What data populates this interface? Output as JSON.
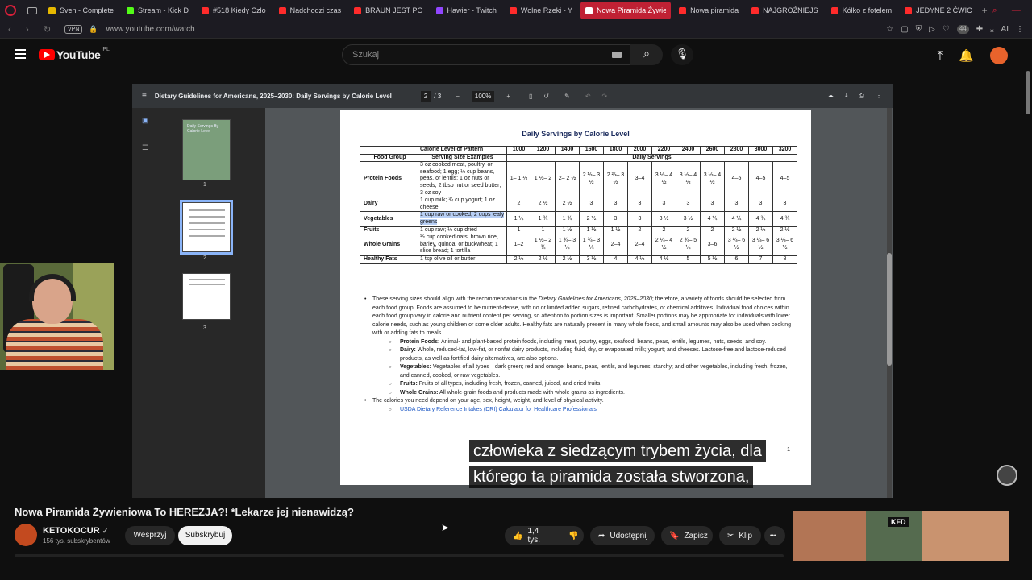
{
  "browser": {
    "tabs": [
      {
        "label": "Sven - Complete",
        "color": "#e6b800"
      },
      {
        "label": "Stream - Kick D",
        "color": "#53fc18"
      },
      {
        "label": "#518 Kiedy Czło",
        "color": "#ff2b2b"
      },
      {
        "label": "Nadchodzi czas",
        "color": "#ff2b2b"
      },
      {
        "label": "BRAUN JEST PO",
        "color": "#ff2b2b"
      },
      {
        "label": "Hawier - Twitch",
        "color": "#9146ff"
      },
      {
        "label": "Wolne Rzeki - Y",
        "color": "#ff2b2b"
      },
      {
        "label": "Nowa Piramida Żywien",
        "color": "#ffffff",
        "active": true
      },
      {
        "label": "Nowa piramida",
        "color": "#ff2b2b"
      },
      {
        "label": "NAJGROŹNIEJS",
        "color": "#ff2b2b"
      },
      {
        "label": "Kółko z fotelem",
        "color": "#ff2b2b"
      },
      {
        "label": "JEDYNE 2 ĆWIC",
        "color": "#ff2b2b"
      }
    ],
    "new_tab": "+",
    "url": "www.youtube.com/watch",
    "vpn": "VPN",
    "ext_badge": "44",
    "ai_label": "AI"
  },
  "youtube": {
    "logo": "YouTube",
    "country": "PL",
    "search_placeholder": "Szukaj"
  },
  "pdf": {
    "title": "Dietary Guidelines for Americans, 2025–2030: Daily Servings by Calorie Level",
    "page": "2",
    "of": "/ 3",
    "zoom": "100%",
    "thumb1_text": "Daily Servings By Calorie Level",
    "thumbs": [
      "1",
      "2",
      "3"
    ],
    "heading": "Daily Servings by Calorie Level",
    "table": {
      "h1": [
        "",
        "Calorie Level of Pattern",
        "1000",
        "1200",
        "1400",
        "1600",
        "1800",
        "2000",
        "2200",
        "2400",
        "2600",
        "2800",
        "3000",
        "3200"
      ],
      "h2": [
        "Food Group",
        "Serving Size Examples",
        "Daily Servings"
      ],
      "rows": [
        [
          "Protein Foods",
          "3 oz cooked meat, poultry, or seafood; 1 egg; ½ cup beans, peas, or lentils; 1 oz nuts or seeds; 2 tbsp nut or seed butter; 3 oz soy",
          "1– 1 ½",
          "1 ½– 2",
          "2– 2 ½",
          "2 ½– 3 ½",
          "2 ⅔– 3 ½",
          "3–4",
          "3 ½– 4 ½",
          "3 ½– 4 ½",
          "3 ½– 4 ½",
          "4–5",
          "4–5",
          "4–5"
        ],
        [
          "Dairy",
          "1 cup milk; ¾ cup yogurt; 1 oz cheese",
          "2",
          "2 ½",
          "2 ½",
          "3",
          "3",
          "3",
          "3",
          "3",
          "3",
          "3",
          "3",
          "3"
        ],
        [
          "Vegetables",
          "1 cup raw or cooked; 2 cups leafy greens",
          "1 ¼",
          "1 ¾",
          "1 ¾",
          "2 ½",
          "3",
          "3",
          "3 ½",
          "3 ½",
          "4 ¼",
          "4 ¼",
          "4 ¾",
          "4 ¾"
        ],
        [
          "Fruits",
          "1 cup raw; ½ cup dried",
          "1",
          "1",
          "1 ½",
          "1 ½",
          "1 ½",
          "2",
          "2",
          "2",
          "2",
          "2 ½",
          "2 ½",
          "2 ½"
        ],
        [
          "Whole Grains",
          "½ cup cooked oats, brown rice, barley, quinoa, or buckwheat; 1 slice bread; 1 tortilla",
          "1–2",
          "1 ½– 2 ¾",
          "1 ¾– 3 ¼",
          "1 ¾– 3 ¼",
          "2–4",
          "2–4",
          "2 ¼– 4 ½",
          "2 ¾– 5 ¼",
          "3–6",
          "3 ¼– 6 ½",
          "3 ¼– 6 ½",
          "3 ¼– 6 ½"
        ],
        [
          "Healthy Fats",
          "1 tsp olive oil or butter",
          "2 ½",
          "2 ½",
          "2 ½",
          "3 ½",
          "4",
          "4 ½",
          "4 ½",
          "5",
          "5 ½",
          "6",
          "7",
          "8"
        ]
      ]
    },
    "bullet1_a": "These serving sizes should align with the recommendations in the ",
    "bullet1_i": "Dietary Guidelines for Americans, 2025–2030",
    "bullet1_b": "; therefore, a variety of foods should be selected from each food group. Foods are assumed to be nutrient-dense, with no or limited added sugars, refined carbohydrates, or chemical additives. Individual food choices within each food group vary in calorie and nutrient content per serving, so attention to portion sizes is important. Smaller portions may be appropriate for individuals with lower calorie needs, such as young children or some older adults. Healthy fats are naturally present in many whole foods, and small amounts may also be used when cooking with or adding fats to meals.",
    "sub": [
      {
        "k": "Protein Foods:",
        "v": " Animal- and plant-based protein foods, including meat, poultry, eggs, seafood, beans, peas, lentils, legumes, nuts, seeds, and soy."
      },
      {
        "k": "Dairy:",
        "v": " Whole, reduced-fat, low-fat, or nonfat dairy products, including fluid, dry, or evaporated milk; yogurt; and cheeses. Lactose-free and lactose-reduced products, as well as fortified dairy alternatives, are also options."
      },
      {
        "k": "Vegetables:",
        "v": " Vegetables of all types—dark green; red and orange; beans, peas, lentils, and legumes; starchy; and other vegetables, including fresh, frozen, and canned, cooked, or raw vegetables."
      },
      {
        "k": "Fruits:",
        "v": " Fruits of all types, including fresh, frozen, canned, juiced, and dried fruits."
      },
      {
        "k": "Whole Grains:",
        "v": " All whole-grain foods and products made with whole grains as ingredients."
      }
    ],
    "bullet2": "The calories you need depend on your age, sex, height, weight, and level of physical activity.",
    "link": "USDA Dietary Reference Intakes (DRI) Calculator for Healthcare Professionals",
    "page_number": "1"
  },
  "subtitles": {
    "line1": "człowieka z siedzącym trybem życia, dla",
    "line2": "którego ta piramida została stworzona,"
  },
  "video": {
    "title": "Nowa Piramida Żywieniowa To HEREZJA?! *Lekarze jej nienawidzą?",
    "channel": "KETOKOCUR",
    "verified": "✓",
    "subscribers": "156 tys. subskrybentów",
    "join": "Wesprzyj",
    "subscribe": "Subskrybuj",
    "likes": "1,4 tys.",
    "share": "Udostępnij",
    "save": "Zapisz",
    "clip": "Klip",
    "more": "•••"
  },
  "recommendation": {
    "badge": "KFD"
  }
}
